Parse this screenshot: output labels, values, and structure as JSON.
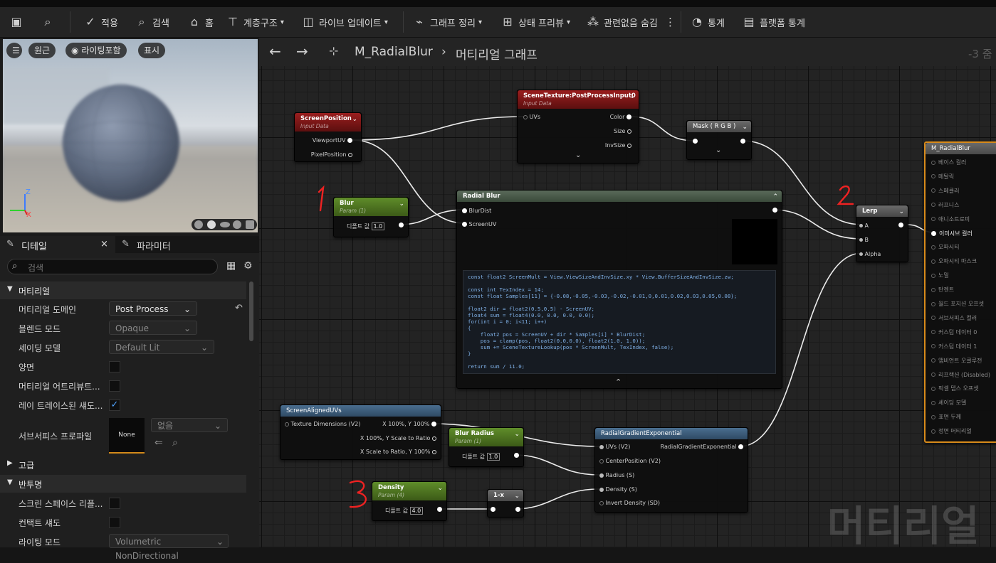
{
  "toolbar": {
    "apply": "적용",
    "search": "검색",
    "home": "홈",
    "hierarchy": "계층구조",
    "live_update": "라이브 업데이트",
    "clean_graph": "그래프 정리",
    "preview_state": "상태 프리뷰",
    "hide_unrelated": "관련없음 숨김",
    "stats": "통계",
    "platform_stats": "플랫폼 통계"
  },
  "viewport": {
    "perspective": "원근",
    "lit_incl": "라이팅포함",
    "show": "표시"
  },
  "details": {
    "tab_details": "디테일",
    "tab_params": "파라미터",
    "search_placeholder": "검색",
    "cat_material": "머티리얼",
    "material_domain_label": "머티리얼 도메인",
    "material_domain_value": "Post Process",
    "blend_mode_label": "블렌드 모드",
    "blend_mode_value": "Opaque",
    "shading_model_label": "셰이딩 모델",
    "shading_model_value": "Default Lit",
    "two_sided_label": "양면",
    "material_attr_label": "머티리얼 어트리뷰트...",
    "raytraced_shadow_label": "레이 트레이스된 섀도...",
    "subsurface_label": "서브서피스 프로파일",
    "subsurface_thumb": "None",
    "subsurface_value": "없음",
    "cat_advanced": "고급",
    "cat_translucency": "반투명",
    "screen_space_label": "스크린 스페이스 리플...",
    "contact_shadow_label": "컨택트 섀도",
    "lighting_mode_label": "라이팅 모드",
    "lighting_mode_value": "Volumetric NonDirectional"
  },
  "graph": {
    "asset_name": "M_RadialBlur",
    "graph_name": "머티리얼 그래프",
    "zoom": "-3 줌",
    "watermark": "머티리얼"
  },
  "nodes": {
    "screen_position": {
      "title": "ScreenPosition",
      "sub": "Input Data",
      "pin1": "ViewportUV",
      "pin2": "PixelPosition"
    },
    "scene_texture": {
      "title": "SceneTexture:PostProcessInput0",
      "sub": "Input Data",
      "in1": "UVs",
      "out1": "Color",
      "out2": "Size",
      "out3": "InvSize"
    },
    "mask": {
      "title": "Mask ( R G B )"
    },
    "blur": {
      "title": "Blur",
      "sub": "Param (1)",
      "default_label": "디폴트 값",
      "default_value": "1.0"
    },
    "radial_blur": {
      "title": "Radial Blur",
      "in1": "BlurDist",
      "in2": "ScreenUV",
      "code": "const float2 ScreenMult = View.ViewSizeAndInvSize.xy * View.BufferSizeAndInvSize.zw;\n\nconst int TexIndex = 14;\nconst float Samples[11] = {-0.08,-0.05,-0.03,-0.02,-0.01,0,0.01,0.02,0.03,0.05,0.08};\n\nfloat2 dir = float2(0.5,0.5) - ScreenUV;\nfloat4 sum = float4(0.0, 0.0, 0.0, 0.0);\nfor(int i = 0; i<11; i++)\n{\n    float2 pos = ScreenUV + dir * Samples[i] * BlurDist;\n    pos = clamp(pos, float2(0.0,0.0), float2(1.0, 1.0));\n    sum += SceneTextureLookup(pos * ScreenMult, TexIndex, false);\n}\n\nreturn sum / 11.0;"
    },
    "lerp": {
      "title": "Lerp",
      "in1": "A",
      "in2": "B",
      "in3": "Alpha"
    },
    "screen_aligned": {
      "title": "ScreenAlignedUVs",
      "in1": "Texture Dimensions (V2)",
      "out1": "X 100%, Y 100%",
      "out2": "X 100%, Y Scale to Ratio",
      "out3": "X Scale to Ratio, Y 100%"
    },
    "blur_radius": {
      "title": "Blur Radius",
      "sub": "Param (1)",
      "default_label": "디폴트 값",
      "default_value": "1.0"
    },
    "radial_gradient": {
      "title": "RadialGradientExponential",
      "in1": "UVs (V2)",
      "in2": "CenterPosition (V2)",
      "in3": "Radius (S)",
      "in4": "Density (S)",
      "in5": "Invert Density (SD)",
      "out1": "RadialGradientExponential"
    },
    "density": {
      "title": "Density",
      "sub": "Param (4)",
      "default_label": "디폴트 값",
      "default_value": "4.0"
    },
    "one_minus": {
      "title": "1-x"
    },
    "material_output": {
      "title": "M_RadialBlur",
      "pins": [
        "베이스 컬러",
        "메탈릭",
        "스페큘러",
        "러프니스",
        "애니소트로피",
        "이미시브 컬러",
        "오파시티",
        "오파시티 마스크",
        "노멀",
        "탄젠트",
        "월드 포지션 오프셋",
        "서브서피스 컬러",
        "커스텀 데이터 0",
        "커스텀 데이터 1",
        "앰비언트 오클루전",
        "리프랙션 (Disabled)",
        "픽셀 뎁스 오프셋",
        "셰이딩 모델",
        "표면 두께",
        "정면 머티리얼"
      ]
    }
  },
  "annotations": {
    "a1": "1",
    "a2": "2",
    "a3": "3"
  }
}
